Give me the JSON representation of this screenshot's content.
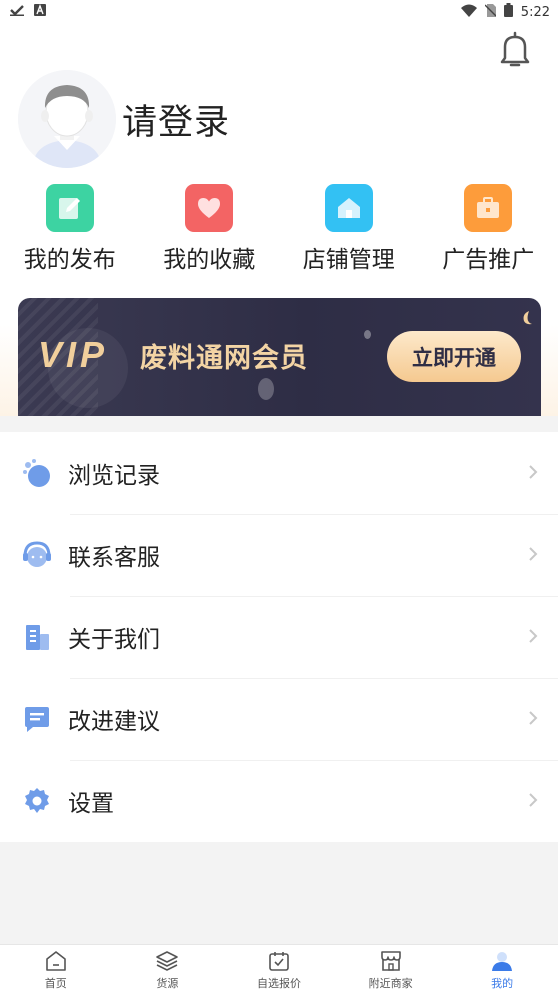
{
  "status_bar": {
    "time": "5:22"
  },
  "profile": {
    "login_text": "请登录"
  },
  "quick_actions": [
    {
      "label": "我的发布",
      "icon": "edit-icon",
      "color": "#3dd3a2"
    },
    {
      "label": "我的收藏",
      "icon": "heart-icon",
      "color": "#f36464"
    },
    {
      "label": "店铺管理",
      "icon": "home-icon",
      "color": "#33c1f3"
    },
    {
      "label": "广告推广",
      "icon": "briefcase-icon",
      "color": "#fd9c3b"
    }
  ],
  "vip": {
    "logo": "VIP",
    "title": "废料通网会员",
    "button": "立即开通"
  },
  "menu": [
    {
      "label": "浏览记录",
      "icon": "history-icon"
    },
    {
      "label": "联系客服",
      "icon": "customer-service-icon"
    },
    {
      "label": "关于我们",
      "icon": "building-icon"
    },
    {
      "label": "改进建议",
      "icon": "message-icon"
    },
    {
      "label": "设置",
      "icon": "gear-icon"
    }
  ],
  "tabs": [
    {
      "label": "首页",
      "icon": "home-tab-icon"
    },
    {
      "label": "货源",
      "icon": "layers-icon"
    },
    {
      "label": "自选报价",
      "icon": "calendar-check-icon"
    },
    {
      "label": "附近商家",
      "icon": "shop-icon"
    },
    {
      "label": "我的",
      "icon": "profile-icon"
    }
  ],
  "colors": {
    "accent": "#3b7be8",
    "menu_icon": "#6f9ce8",
    "vip_gold": "#f1cf9c"
  }
}
